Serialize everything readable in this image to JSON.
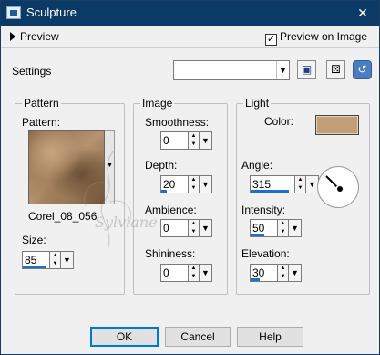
{
  "window": {
    "title": "Sculpture",
    "close_glyph": "✕",
    "title_bg": "#0b3a66"
  },
  "preview": {
    "label": "Preview",
    "preview_on_image_label": "Preview on Image",
    "preview_on_image_checked": true
  },
  "settings": {
    "label": "Settings",
    "value": ""
  },
  "pattern_group": {
    "title": "Pattern",
    "pattern_label": "Pattern:",
    "pattern_name": "Corel_08_056",
    "size_label": "Size:",
    "size_value": "85",
    "size_level": 0.85
  },
  "image_group": {
    "title": "Image",
    "smoothness_label": "Smoothness:",
    "smoothness_value": "0",
    "smoothness_level": 0,
    "depth_label": "Depth:",
    "depth_value": "20",
    "depth_level": 0.2,
    "ambience_label": "Ambience:",
    "ambience_value": "0",
    "ambience_level": 0,
    "shininess_label": "Shininess:",
    "shininess_value": "0",
    "shininess_level": 0
  },
  "light_group": {
    "title": "Light",
    "color_label": "Color:",
    "color_value": "#c39f77",
    "angle_label": "Angle:",
    "angle_value": "315",
    "angle_level": 0.875,
    "intensity_label": "Intensity:",
    "intensity_value": "50",
    "intensity_level": 0.5,
    "elevation_label": "Elevation:",
    "elevation_value": "30",
    "elevation_level": 0.33
  },
  "buttons": {
    "ok": "OK",
    "cancel": "Cancel",
    "help": "Help"
  },
  "watermark": {
    "text": "Sylviane"
  },
  "icons": {
    "app": "sculpture-app-icon",
    "save": "save-preset-icon",
    "random": "randomize-dice-icon",
    "reset": "reset-icon",
    "dropdown": "chevron-down-icon",
    "spinner": "up-down-arrows-icon"
  }
}
